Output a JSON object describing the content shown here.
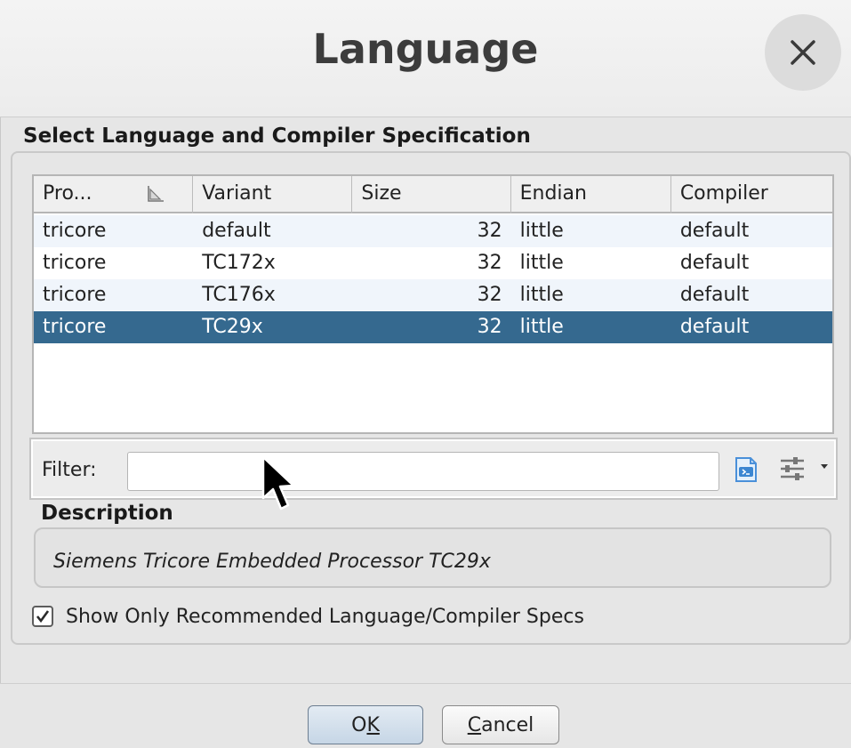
{
  "dialog": {
    "title": "Language"
  },
  "section_title": "Select Language and Compiler Specification",
  "table": {
    "columns": [
      "Pro...",
      "Variant",
      "Size",
      "Endian",
      "Compiler"
    ],
    "rows": [
      [
        "tricore",
        "default",
        "32",
        "little",
        "default"
      ],
      [
        "tricore",
        "TC172x",
        "32",
        "little",
        "default"
      ],
      [
        "tricore",
        "TC176x",
        "32",
        "little",
        "default"
      ],
      [
        "tricore",
        "TC29x",
        "32",
        "little",
        "default"
      ]
    ],
    "selected_index": 3
  },
  "filter": {
    "label": "Filter:",
    "value": ""
  },
  "description": {
    "label": "Description",
    "text": "Siemens Tricore Embedded Processor TC29x"
  },
  "recommended_checkbox": {
    "label": "Show Only Recommended Language/Compiler Specs",
    "checked": true
  },
  "buttons": {
    "ok": {
      "label_pre": "O",
      "label_mnemonic": "K",
      "label_post": ""
    },
    "cancel": {
      "label_pre": "",
      "label_mnemonic": "C",
      "label_post": "ancel"
    }
  },
  "colors": {
    "selection": "#35698f",
    "alt_row": "#f0f5fb"
  },
  "icons": [
    "close-icon",
    "sort-icon",
    "filter-options-icon",
    "settings-sliders-icon",
    "dropdown-arrow-icon",
    "checkmark-icon",
    "mouse-cursor-icon"
  ]
}
